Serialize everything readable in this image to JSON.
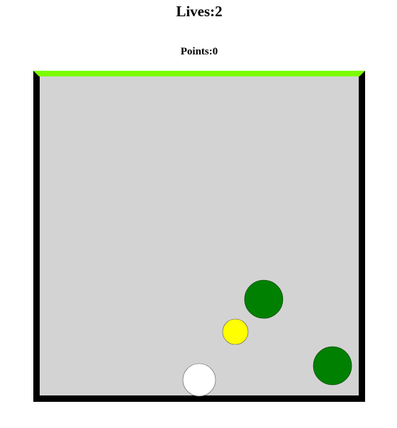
{
  "hud": {
    "lives_label": "Lives:2",
    "points_label": "Points:0"
  },
  "colors": {
    "background": "#ffffff",
    "field": "#d3d3d3",
    "wall": "#000000",
    "goal_edge": "#7cfc00",
    "player": "#ffffff",
    "target": "#ffff00",
    "enemy": "#008000"
  },
  "objects": {
    "player_ball": "white-circle",
    "target_ball": "yellow-circle",
    "enemy_balls": [
      "green-circle",
      "green-circle"
    ]
  }
}
